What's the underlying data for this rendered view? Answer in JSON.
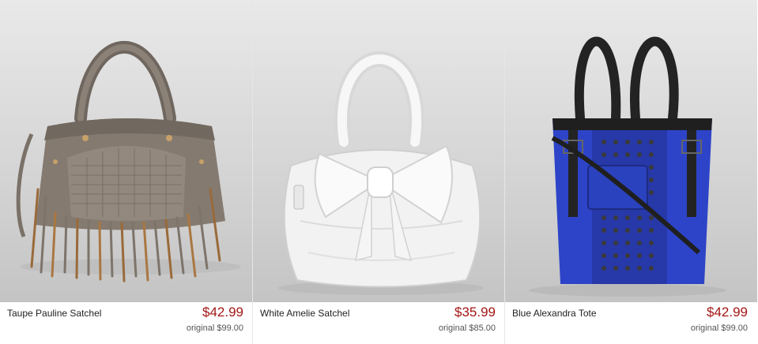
{
  "products": [
    {
      "name": "Taupe Pauline Satchel",
      "price": "$42.99",
      "original_price": "original $99.00",
      "image_icon": "taupe-fringe-satchel-image",
      "accent_color": "#7d746a"
    },
    {
      "name": "White Amelie Satchel",
      "price": "$35.99",
      "original_price": "original $85.00",
      "image_icon": "white-bow-satchel-image",
      "accent_color": "#f2f2f2"
    },
    {
      "name": "Blue Alexandra Tote",
      "price": "$42.99",
      "original_price": "original $99.00",
      "image_icon": "blue-studded-tote-image",
      "accent_color": "#2d44c8"
    }
  ],
  "colors": {
    "price": "#a41616",
    "text": "#222222",
    "muted": "#555555"
  }
}
